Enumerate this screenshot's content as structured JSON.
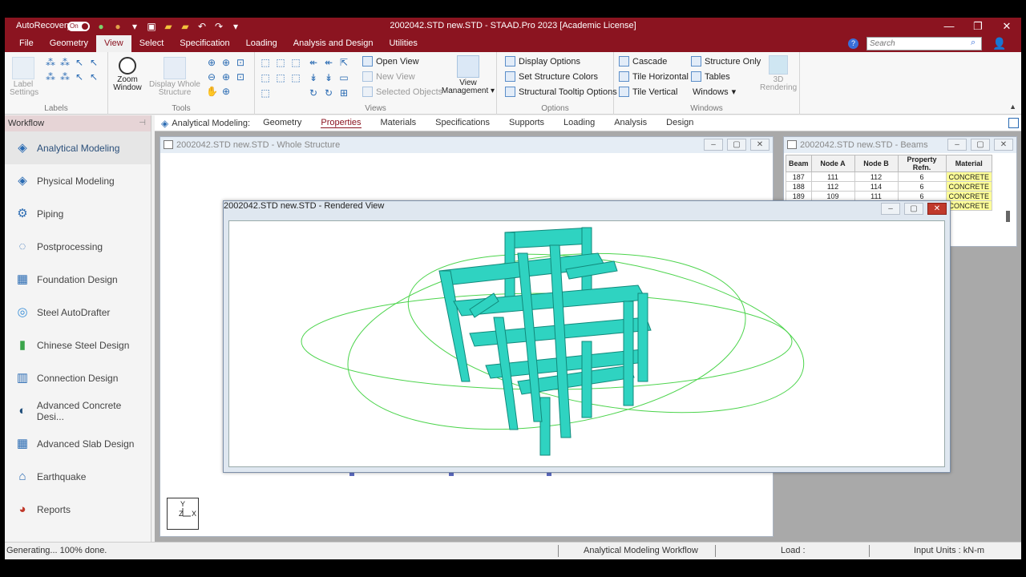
{
  "titlebar": {
    "autorecovery": "AutoRecovery",
    "toggle_state": "On",
    "title": "2002042.STD new.STD - STAAD.Pro 2023 [Academic License]"
  },
  "menu": {
    "tabs": [
      "File",
      "Geometry",
      "View",
      "Select",
      "Specification",
      "Loading",
      "Analysis and Design",
      "Utilities"
    ],
    "active": "View",
    "search_placeholder": "Search"
  },
  "ribbon": {
    "labels_group": {
      "button": "Label Settings",
      "label": "Labels"
    },
    "tools_group": {
      "zoom_window": "Zoom Window",
      "display_whole": "Display Whole Structure",
      "label": "Tools"
    },
    "views_group": {
      "open_view": "Open View",
      "new_view": "New View",
      "selected_objects": "Selected Objects",
      "view_management": "View Management",
      "label": "Views"
    },
    "options_group": {
      "display_options": "Display Options",
      "set_structure_colors": "Set Structure Colors",
      "structural_tooltip_options": "Structural Tooltip Options",
      "label": "Options"
    },
    "windows_group": {
      "cascade": "Cascade",
      "tile_horizontal": "Tile Horizontal",
      "tile_vertical": "Tile Vertical",
      "structure_only": "Structure Only",
      "tables": "Tables",
      "windows": "Windows",
      "label": "Windows"
    },
    "rendering": "3D Rendering"
  },
  "workflow": {
    "header": "Workflow",
    "items": [
      {
        "label": "Analytical Modeling",
        "icon": "analytical-modeling-icon"
      },
      {
        "label": "Physical Modeling",
        "icon": "physical-modeling-icon"
      },
      {
        "label": "Piping",
        "icon": "piping-icon"
      },
      {
        "label": "Postprocessing",
        "icon": "postprocessing-icon"
      },
      {
        "label": "Foundation Design",
        "icon": "foundation-design-icon"
      },
      {
        "label": "Steel AutoDrafter",
        "icon": "steel-autodrafter-icon"
      },
      {
        "label": "Chinese Steel Design",
        "icon": "chinese-steel-design-icon"
      },
      {
        "label": "Connection Design",
        "icon": "connection-design-icon"
      },
      {
        "label": "Advanced Concrete Desi...",
        "icon": "advanced-concrete-design-icon"
      },
      {
        "label": "Advanced Slab Design",
        "icon": "advanced-slab-design-icon"
      },
      {
        "label": "Earthquake",
        "icon": "earthquake-icon"
      },
      {
        "label": "Reports",
        "icon": "reports-icon"
      }
    ]
  },
  "subtabs": {
    "prefix": "Analytical Modeling:",
    "items": [
      "Geometry",
      "Properties",
      "Materials",
      "Specifications",
      "Supports",
      "Loading",
      "Analysis",
      "Design"
    ],
    "active": "Properties"
  },
  "windows": {
    "whole_structure": "2002042.STD new.STD - Whole Structure",
    "beams": "2002042.STD new.STD - Beams",
    "rendered": "2002042.STD new.STD - Rendered View"
  },
  "beams_table": {
    "headers": [
      "Beam",
      "Node A",
      "Node B",
      "Property Refn.",
      "Material"
    ],
    "rows": [
      [
        "187",
        "111",
        "112",
        "6",
        "CONCRETE"
      ],
      [
        "188",
        "112",
        "114",
        "6",
        "CONCRETE"
      ],
      [
        "189",
        "109",
        "111",
        "6",
        "CONCRETE"
      ],
      [
        "",
        "",
        "",
        "",
        "CONCRETE"
      ]
    ]
  },
  "axis": {
    "y": "Y",
    "z": "Z",
    "x": "X"
  },
  "status": {
    "left": "Generating... 100% done.",
    "workflow": "Analytical Modeling Workflow",
    "load": "Load :",
    "units": "Input Units : kN-m"
  }
}
